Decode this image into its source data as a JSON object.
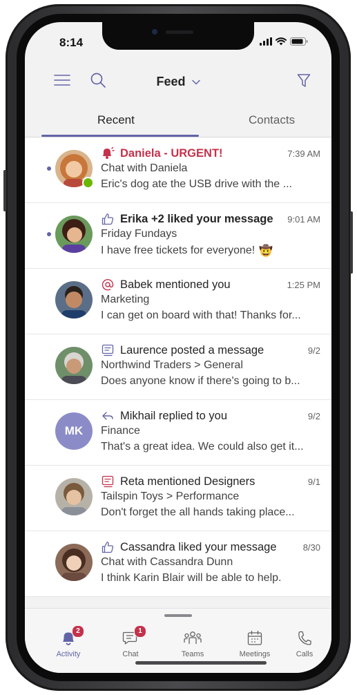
{
  "status_bar": {
    "time": "8:14"
  },
  "header": {
    "title": "Feed"
  },
  "tabs": [
    {
      "label": "Recent",
      "active": true
    },
    {
      "label": "Contacts",
      "active": false
    }
  ],
  "feed": [
    {
      "title": "Daniela - URGENT!",
      "type": "urgent-icon",
      "time": "7:39 AM",
      "context": "Chat with Daniela",
      "preview": "Eric's dog ate the USB drive with the ...",
      "unread": true,
      "presence": "available",
      "avatar": "photo"
    },
    {
      "title": "Erika +2 liked your message",
      "type": "like-icon",
      "time": "9:01 AM",
      "context": "Friday Fundays",
      "preview": "I have free tickets for everyone!",
      "emoji": "🤠",
      "unread": true,
      "avatar": "photo"
    },
    {
      "title": "Babek mentioned you",
      "type": "mention-icon",
      "time": "1:25 PM",
      "context": "Marketing",
      "preview": "I can get on board with that! Thanks for...",
      "unread": false,
      "avatar": "photo"
    },
    {
      "title": "Laurence posted a message",
      "type": "post-icon",
      "time": "9/2",
      "context": "Northwind Traders > General",
      "preview": "Does anyone know if there's going to b...",
      "unread": false,
      "avatar": "photo"
    },
    {
      "title": "Mikhail replied to you",
      "type": "reply-icon",
      "time": "9/2",
      "context": "Finance",
      "preview": "That's a great idea. We could also get it...",
      "unread": false,
      "avatar": "initials",
      "initials": "MK"
    },
    {
      "title": "Reta mentioned Designers",
      "type": "team-mention-icon",
      "time": "9/1",
      "context": "Tailspin Toys > Performance",
      "preview": "Don't forget the all hands taking place...",
      "unread": false,
      "avatar": "photo"
    },
    {
      "title": "Cassandra liked your message",
      "type": "like-icon",
      "time": "8/30",
      "context": "Chat with Cassandra Dunn",
      "preview": "I think Karin Blair will be able to help.",
      "unread": false,
      "avatar": "photo"
    }
  ],
  "tabbar": [
    {
      "label": "Activity",
      "icon": "bell-icon",
      "badge": "2",
      "active": true
    },
    {
      "label": "Chat",
      "icon": "chat-icon",
      "badge": "1",
      "active": false
    },
    {
      "label": "Teams",
      "icon": "teams-icon",
      "active": false
    },
    {
      "label": "Meetings",
      "icon": "calendar-icon",
      "active": false
    },
    {
      "label": "Calls",
      "icon": "phone-icon",
      "active": false
    }
  ],
  "colors": {
    "accent": "#6264a7",
    "urgent": "#c4314b",
    "presence_available": "#6bb700",
    "badge": "#c4314b"
  }
}
